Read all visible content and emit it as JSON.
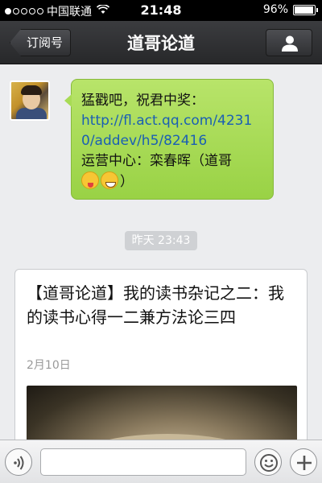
{
  "status_bar": {
    "signal_dots": 5,
    "signal_strength": 1,
    "carrier": "中国联通",
    "wifi_icon": "wifi-icon",
    "time": "21:48",
    "battery_percent": "96%",
    "battery_level": 0.96
  },
  "nav": {
    "back_label": "订阅号",
    "title": "道哥论道",
    "profile_icon": "person-icon"
  },
  "message": {
    "line1": "猛戳吧，祝君中奖：",
    "link": "http://fl.act.qq.com/42310/addev/h5/82416",
    "line3": "运营中心：栾春晖（道哥",
    "emoji1": "tongue-out-emoji",
    "emoji2": "grin-emoji",
    "closing": "）"
  },
  "timestamp": "昨天 23:43",
  "article": {
    "title": "【道哥论道】我的读书杂记之二：我的读书心得一二兼方法论三四",
    "date": "2月10日",
    "image": "open-book-photo"
  },
  "input_bar": {
    "voice_icon": "voice-icon",
    "emoji_icon": "smiley-icon",
    "plus_icon": "plus-icon",
    "text_value": ""
  }
}
